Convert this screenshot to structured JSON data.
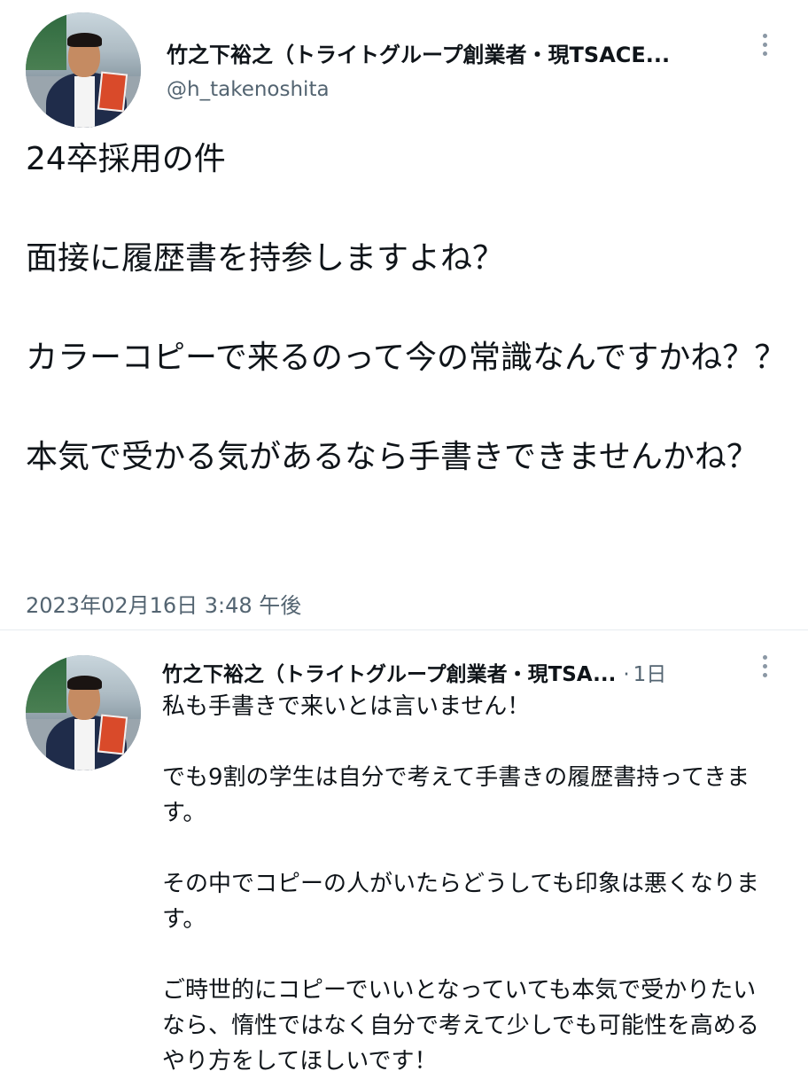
{
  "main_tweet": {
    "author": {
      "display_name": "竹之下裕之（トライトグループ創業者・現TSACE...",
      "handle": "@h_takenoshita",
      "avatar_icon": "profile-photo"
    },
    "body": [
      "24卒採用の件",
      "面接に履歴書を持参しますよね？",
      "カラーコピーで来るのって今の常識なんですかね？？",
      "本気で受かる気があるなら手書きできませんかね？"
    ],
    "timestamp": "2023年02月16日 3:48 午後"
  },
  "reply_tweet": {
    "author": {
      "display_name": "竹之下裕之（トライトグループ創業者・現TSA...",
      "separator": "·",
      "age": "1日",
      "avatar_icon": "profile-photo"
    },
    "body": [
      "私も手書きで来いとは言いません！",
      "でも9割の学生は自分で考えて手書きの履歴書持ってきます。",
      "その中でコピーの人がいたらどうしても印象は悪くなります。",
      "ご時世的にコピーでいいとなっていても本気で受かりたいなら、惰性ではなく自分で考えて少しでも可能性を高めるやり方をしてほしいです！"
    ]
  },
  "colors": {
    "text_primary": "#0f1419",
    "text_secondary": "#536471",
    "divider": "#e6ecf0",
    "icon_gray": "#8b98a5"
  }
}
